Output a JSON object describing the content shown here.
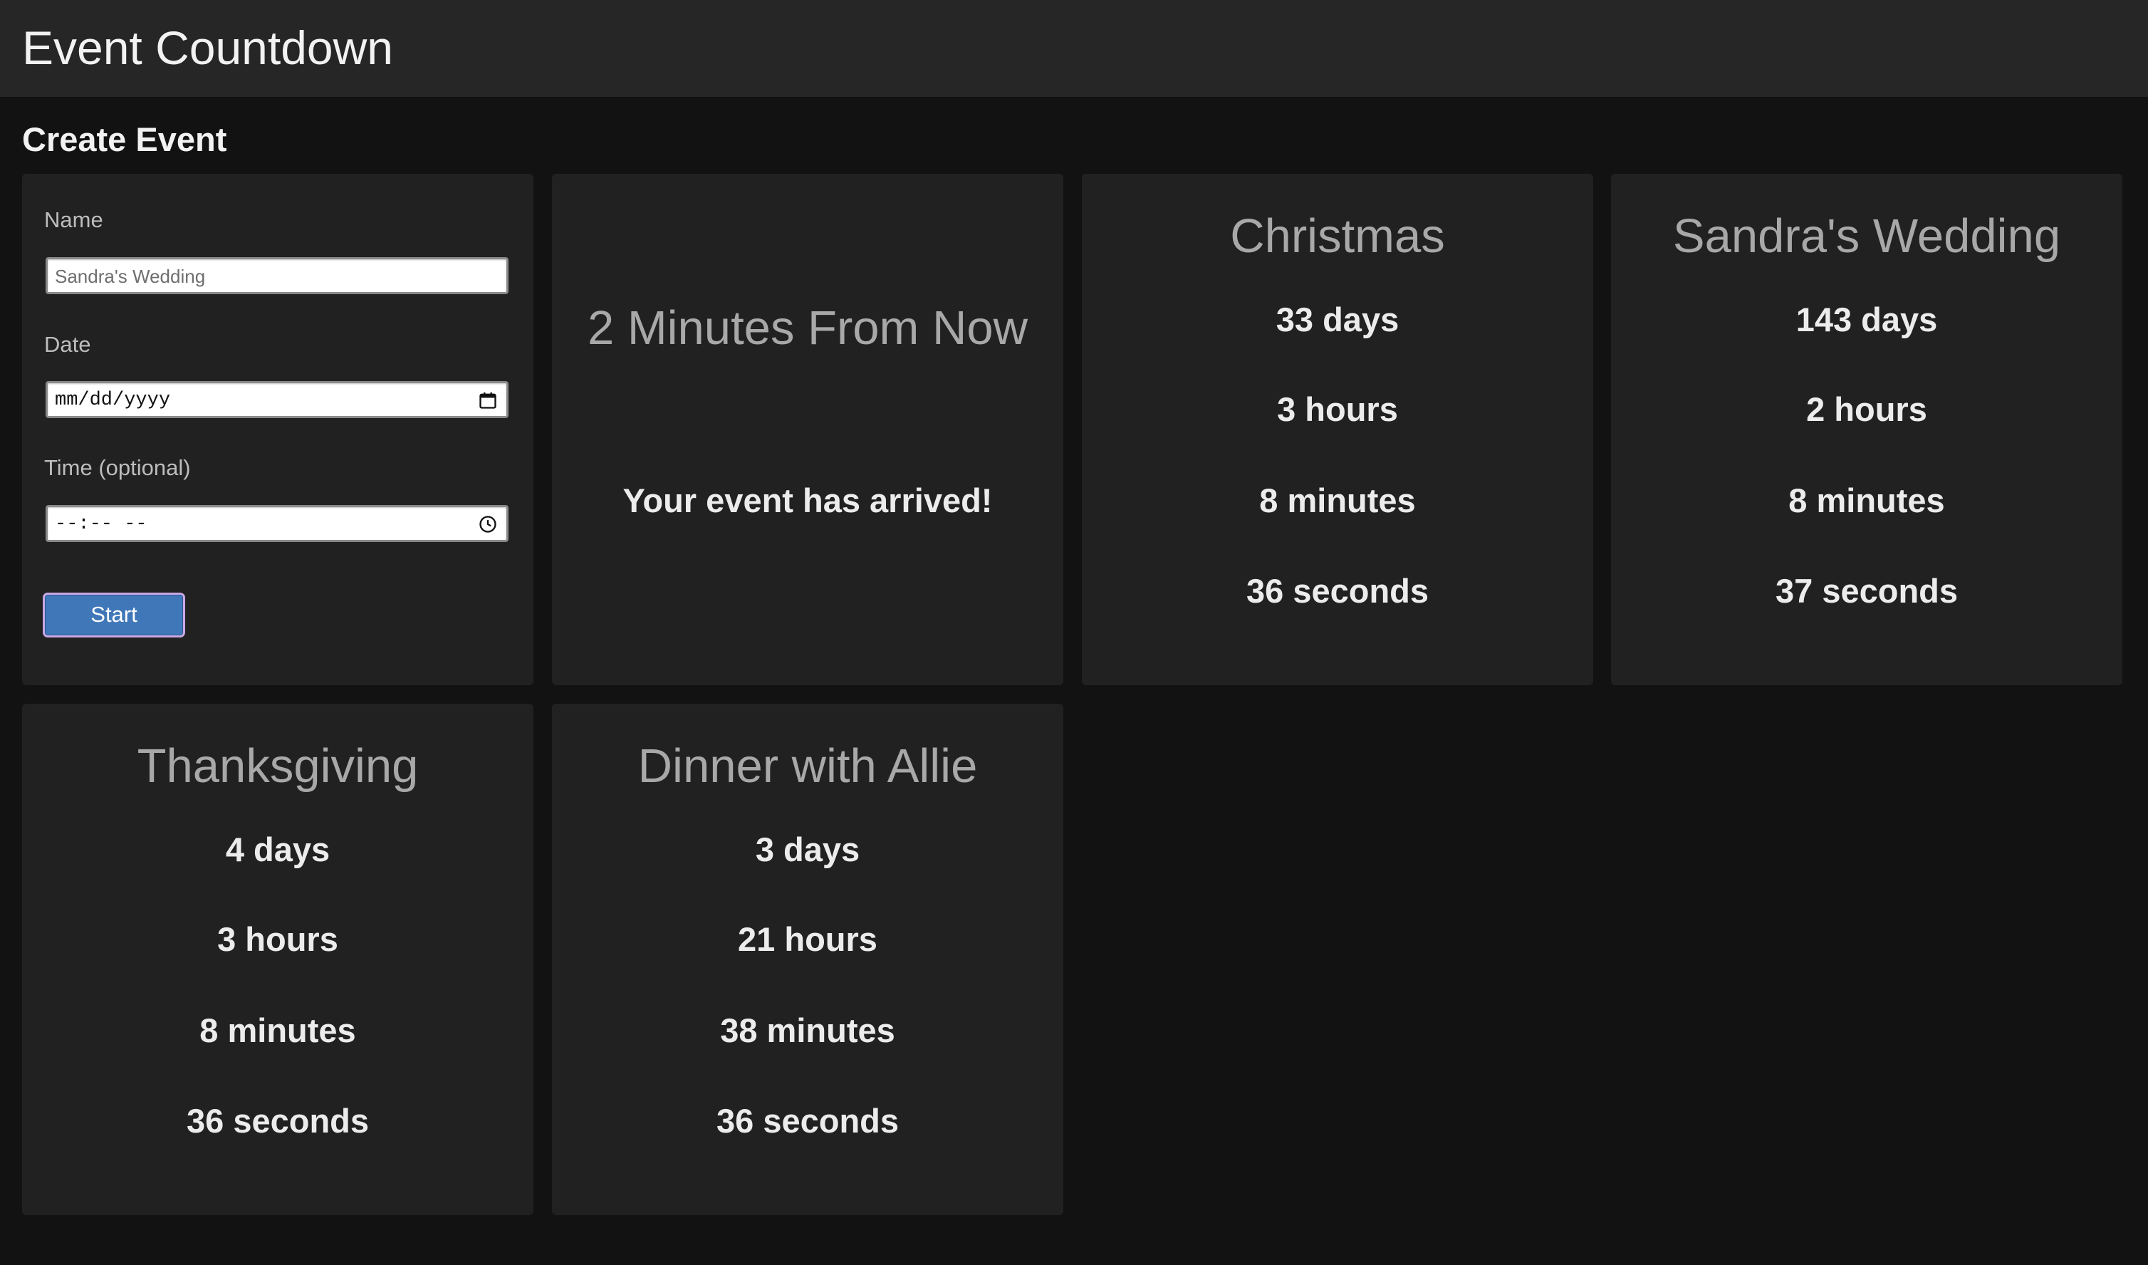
{
  "header": {
    "title": "Event Countdown"
  },
  "form": {
    "heading": "Create Event",
    "name_label": "Name",
    "name_placeholder": "Sandra's Wedding",
    "date_label": "Date",
    "date_placeholder": "mm/dd/yyyy",
    "time_label": "Time (optional)",
    "time_placeholder": "--:-- --",
    "start_label": "Start"
  },
  "events": [
    {
      "title": "2 Minutes From Now",
      "arrived_message": "Your event has arrived!"
    },
    {
      "title": "Christmas",
      "days": "33 days",
      "hours": "3 hours",
      "minutes": "8 minutes",
      "seconds": "36 seconds"
    },
    {
      "title": "Sandra's Wedding",
      "days": "143 days",
      "hours": "2 hours",
      "minutes": "8 minutes",
      "seconds": "37 seconds"
    },
    {
      "title": "Thanksgiving",
      "days": "4 days",
      "hours": "3 hours",
      "minutes": "8 minutes",
      "seconds": "36 seconds"
    },
    {
      "title": "Dinner with Allie",
      "days": "3 days",
      "hours": "21 hours",
      "minutes": "38 minutes",
      "seconds": "36 seconds"
    }
  ]
}
